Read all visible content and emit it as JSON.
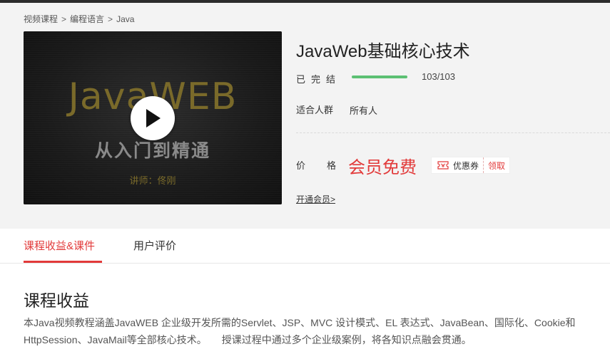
{
  "breadcrumb": {
    "items": [
      "视频课程",
      "编程语言",
      "Java"
    ],
    "separator": ">"
  },
  "video": {
    "title_text": "JavaWEB",
    "subtitle_text": "从入门到精通",
    "teacher_text": "讲师：佟刚"
  },
  "course": {
    "title": "JavaWeb基础核心技术",
    "status_label": "已完结",
    "progress": {
      "current": 103,
      "total": 103,
      "text": "103/103",
      "fraction": 1.0
    },
    "audience_label": "适合人群",
    "audience_value": "所有人",
    "price_label": "价格",
    "price_value": "会员免费",
    "coupon": {
      "label": "优惠券",
      "action": "领取"
    },
    "vip_link": "开通会员>"
  },
  "tabs": [
    {
      "label": "课程收益&课件",
      "active": true
    },
    {
      "label": "用户评价",
      "active": false
    }
  ],
  "section": {
    "title": "课程收益",
    "description": "本Java视频教程涵盖JavaWEB 企业级开发所需的Servlet、JSP、MVC 设计模式、EL 表达式、JavaBean、国际化、Cookie和HttpSession、JavaMail等全部核心技术。　　授课过程中通过多个企业级案例，将各知识点融会贯通。"
  },
  "colors": {
    "accent": "#e23a3a",
    "progress": "#5cc073",
    "video_gold": "#7a6a2a"
  },
  "icons": [
    "play-icon",
    "coupon-icon"
  ]
}
